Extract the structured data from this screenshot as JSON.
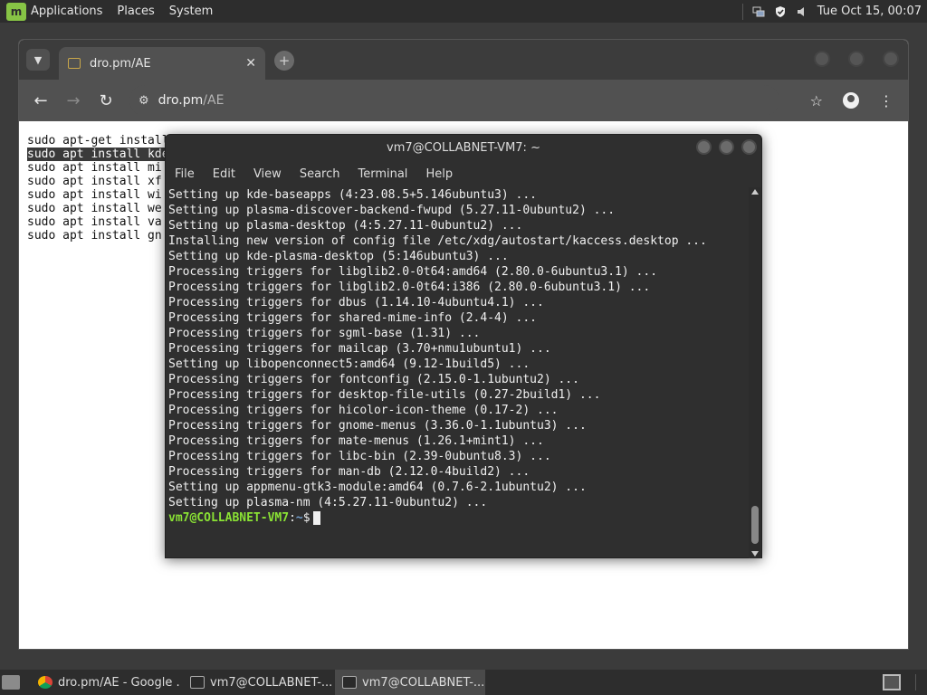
{
  "top_panel": {
    "menus": [
      "Applications",
      "Places",
      "System"
    ],
    "clock": "Tue Oct 15, 00:07"
  },
  "browser": {
    "tab_title": "dro.pm/AE",
    "omnibox": {
      "host": "dro.pm",
      "path": "/AE"
    },
    "page_lines": [
      "sudo apt-get install",
      "sudo apt install kde",
      "sudo apt install mi",
      "sudo apt install xf",
      "sudo apt install wi",
      "sudo apt install we",
      "sudo apt install va",
      "sudo apt install gn"
    ]
  },
  "terminal": {
    "title": "vm7@COLLABNET-VM7: ~",
    "menu": [
      "File",
      "Edit",
      "View",
      "Search",
      "Terminal",
      "Help"
    ],
    "lines": [
      "Setting up kde-baseapps (4:23.08.5+5.146ubuntu3) ...",
      "Setting up plasma-discover-backend-fwupd (5.27.11-0ubuntu2) ...",
      "Setting up plasma-desktop (4:5.27.11-0ubuntu2) ...",
      "Installing new version of config file /etc/xdg/autostart/kaccess.desktop ...",
      "Setting up kde-plasma-desktop (5:146ubuntu3) ...",
      "Processing triggers for libglib2.0-0t64:amd64 (2.80.0-6ubuntu3.1) ...",
      "Processing triggers for libglib2.0-0t64:i386 (2.80.0-6ubuntu3.1) ...",
      "Processing triggers for dbus (1.14.10-4ubuntu4.1) ...",
      "Processing triggers for shared-mime-info (2.4-4) ...",
      "Processing triggers for sgml-base (1.31) ...",
      "Processing triggers for mailcap (3.70+nmu1ubuntu1) ...",
      "Setting up libopenconnect5:amd64 (9.12-1build5) ...",
      "Processing triggers for fontconfig (2.15.0-1.1ubuntu2) ...",
      "Processing triggers for desktop-file-utils (0.27-2build1) ...",
      "Processing triggers for hicolor-icon-theme (0.17-2) ...",
      "Processing triggers for gnome-menus (3.36.0-1.1ubuntu3) ...",
      "Processing triggers for mate-menus (1.26.1+mint1) ...",
      "Processing triggers for libc-bin (2.39-0ubuntu8.3) ...",
      "Processing triggers for man-db (2.12.0-4build2) ...",
      "Setting up appmenu-gtk3-module:amd64 (0.7.6-2.1ubuntu2) ...",
      "Setting up plasma-nm (4:5.27.11-0ubuntu2) ..."
    ],
    "prompt": {
      "user": "vm7@COLLABNET-VM7",
      "sep": ":",
      "path": "~",
      "symbol": "$"
    }
  },
  "taskbar": {
    "tasks": [
      {
        "label": "dro.pm/AE - Google ...",
        "icon": "chrome-icon",
        "active": false
      },
      {
        "label": "vm7@COLLABNET-...",
        "icon": "terminal-icon",
        "active": false
      },
      {
        "label": "vm7@COLLABNET-...",
        "icon": "terminal-icon",
        "active": true
      }
    ]
  }
}
